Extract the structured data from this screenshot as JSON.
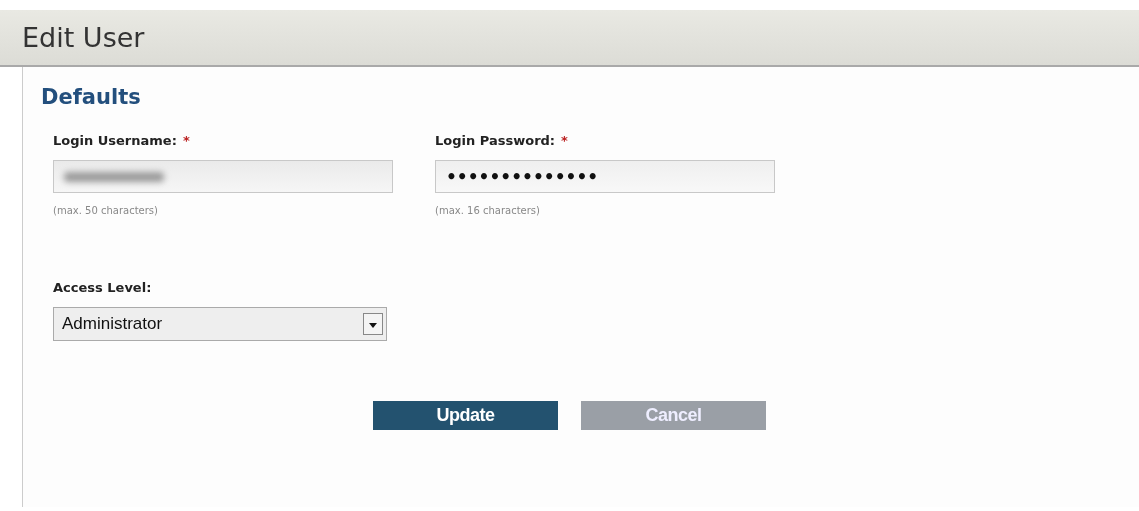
{
  "page": {
    "title": "Edit User"
  },
  "section": {
    "title": "Defaults"
  },
  "fields": [
    {
      "kind": "text",
      "label": "Login Username:",
      "required_mark": "*",
      "hint": "(max. 50 characters)",
      "redacted": true
    },
    {
      "kind": "password",
      "label": "Login Password:",
      "required_mark": "*",
      "hint": "(max. 16 characters)",
      "value": "••••••••••••••"
    }
  ],
  "access_level": {
    "label": "Access Level:",
    "value": "Administrator"
  },
  "buttons": [
    {
      "label": "Update",
      "kind": "primary"
    },
    {
      "label": "Cancel",
      "kind": "secondary"
    }
  ]
}
